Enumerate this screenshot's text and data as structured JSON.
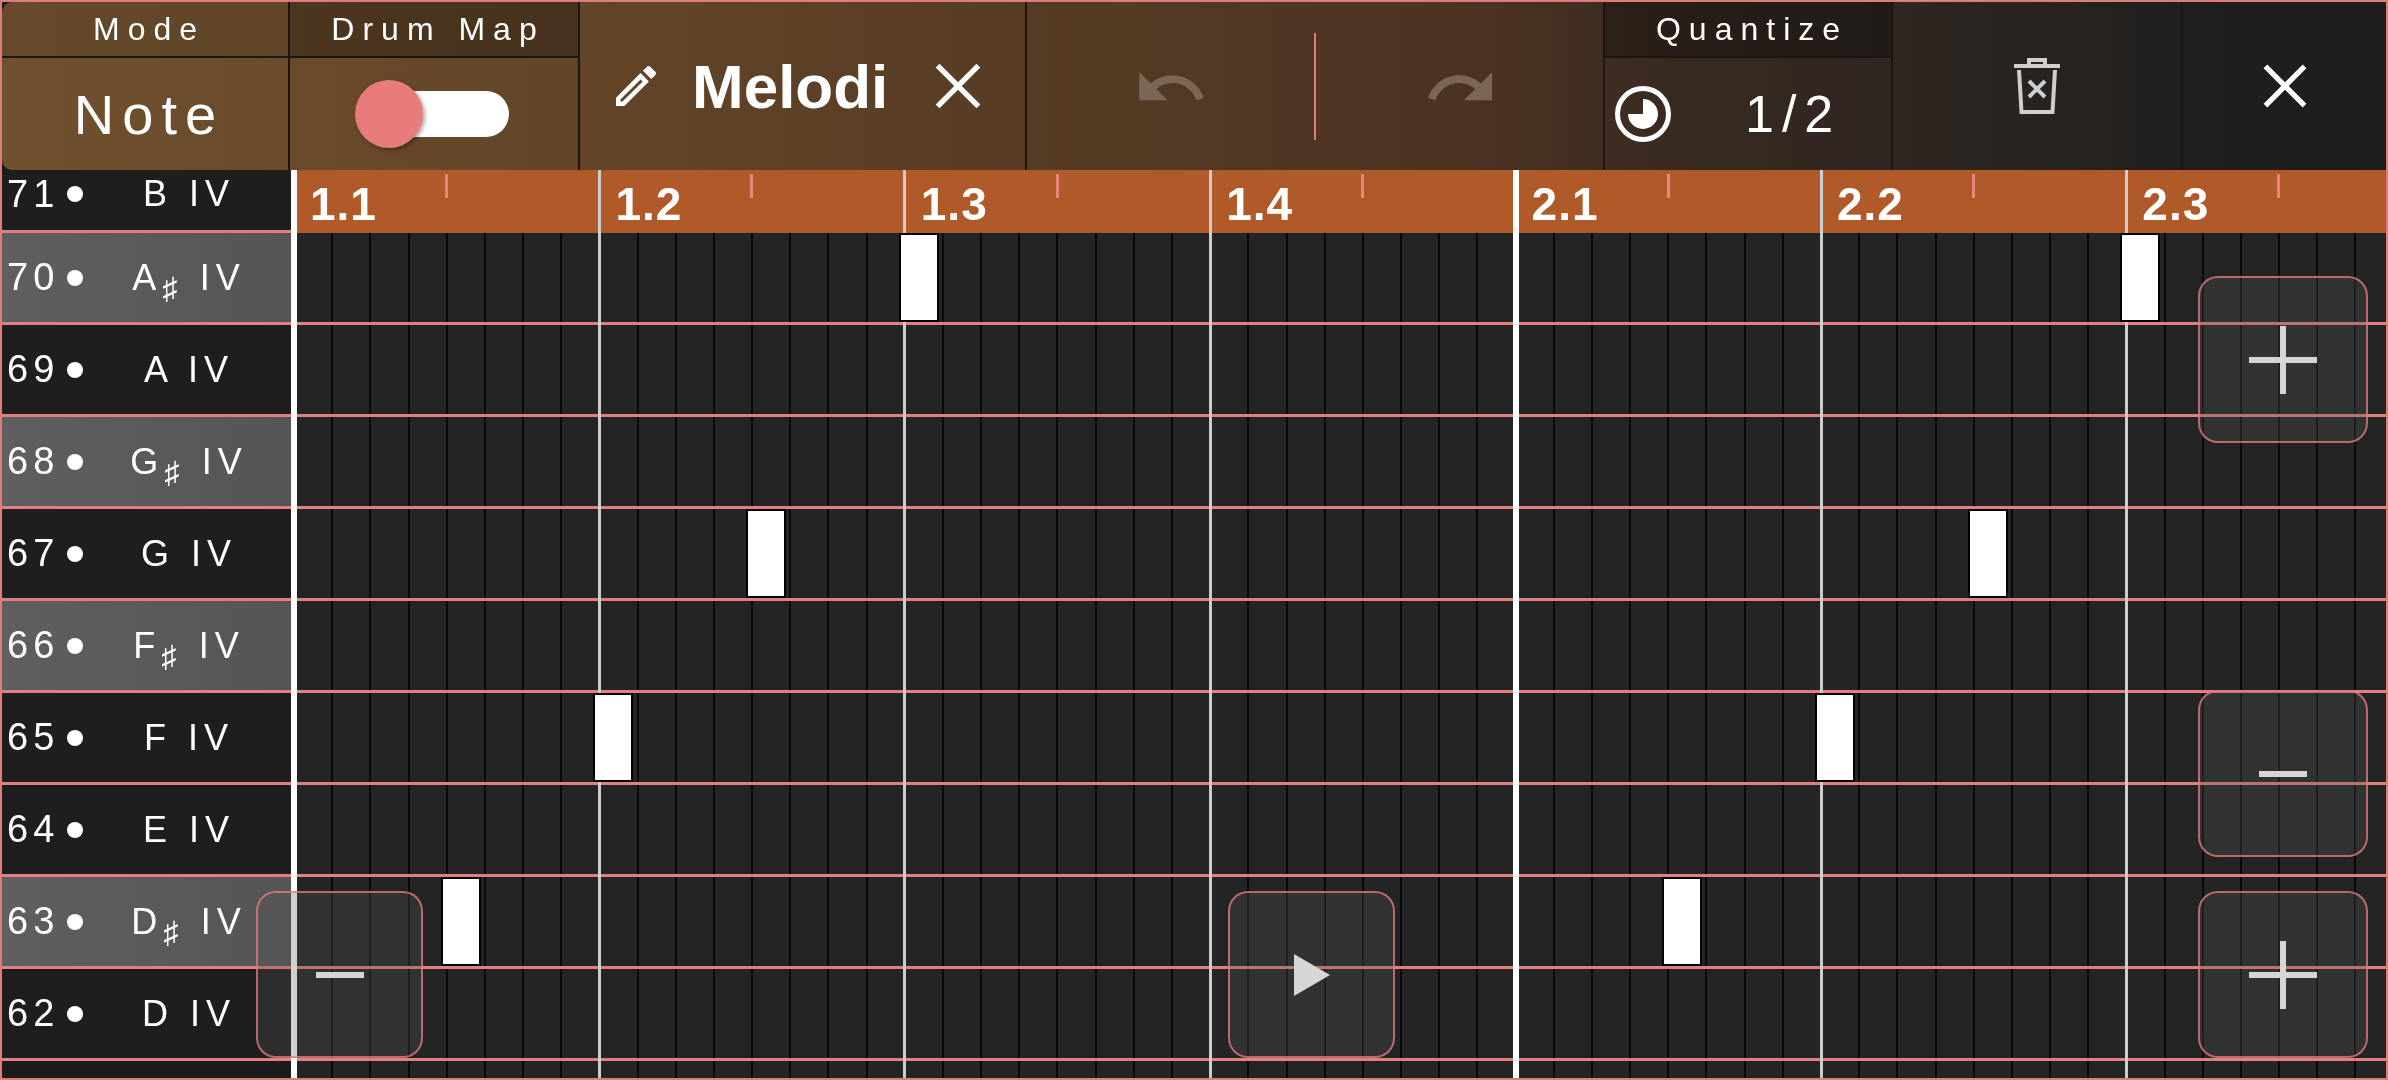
{
  "toolbar": {
    "mode": {
      "label": "Mode",
      "value": "Note"
    },
    "drum_map": {
      "label": "Drum Map",
      "on": false
    },
    "pattern": {
      "name": "Melodi"
    },
    "undo": {
      "disabled": true
    },
    "redo": {
      "disabled": true
    },
    "quantize": {
      "label": "Quantize",
      "value": "1/2"
    }
  },
  "ruler": {
    "beats": [
      {
        "label": "1.1",
        "kind": "bar"
      },
      {
        "label": "1.2",
        "kind": "beat"
      },
      {
        "label": "1.3",
        "kind": "beat"
      },
      {
        "label": "1.4",
        "kind": "beat"
      },
      {
        "label": "2.1",
        "kind": "bar"
      },
      {
        "label": "2.2",
        "kind": "beat"
      },
      {
        "label": "2.3",
        "kind": "beat"
      }
    ]
  },
  "keys": [
    {
      "number": "71",
      "note": "B IV",
      "kind": "natural"
    },
    {
      "number": "70",
      "note": "A$_{♯}$ IV",
      "kind": "sharp",
      "steps": [
        {
          "kind": "rest"
        },
        {
          "kind": "rest"
        },
        {
          "kind": "rest"
        },
        {
          "kind": "rest"
        },
        {
          "kind": "note"
        },
        {
          "kind": "rest"
        },
        {
          "kind": "rest"
        },
        {
          "kind": "rest"
        },
        {
          "kind": "rest"
        },
        {
          "kind": "rest"
        },
        {
          "kind": "rest"
        },
        {
          "kind": "rest"
        },
        {
          "kind": "note"
        },
        {
          "kind": "rest"
        }
      ]
    },
    {
      "number": "69",
      "note": "A IV",
      "kind": "natural",
      "steps": [
        {
          "kind": "rest"
        },
        {
          "kind": "rest"
        },
        {
          "kind": "rest"
        },
        {
          "kind": "rest"
        },
        {
          "kind": "rest"
        },
        {
          "kind": "rest"
        },
        {
          "kind": "rest"
        },
        {
          "kind": "rest"
        },
        {
          "kind": "rest"
        },
        {
          "kind": "rest"
        },
        {
          "kind": "rest"
        },
        {
          "kind": "rest"
        },
        {
          "kind": "rest"
        },
        {
          "kind": "rest"
        }
      ]
    },
    {
      "number": "68",
      "note": "G$_{♯}$ IV",
      "kind": "sharp",
      "steps": [
        {
          "kind": "rest"
        },
        {
          "kind": "rest"
        },
        {
          "kind": "rest"
        },
        {
          "kind": "rest"
        },
        {
          "kind": "rest"
        },
        {
          "kind": "rest"
        },
        {
          "kind": "rest"
        },
        {
          "kind": "rest"
        },
        {
          "kind": "rest"
        },
        {
          "kind": "rest"
        },
        {
          "kind": "rest"
        },
        {
          "kind": "rest"
        },
        {
          "kind": "rest"
        },
        {
          "kind": "rest"
        }
      ]
    },
    {
      "number": "67",
      "note": "G IV",
      "kind": "natural",
      "steps": [
        {
          "kind": "rest"
        },
        {
          "kind": "rest"
        },
        {
          "kind": "rest"
        },
        {
          "kind": "note"
        },
        {
          "kind": "rest"
        },
        {
          "kind": "rest"
        },
        {
          "kind": "rest"
        },
        {
          "kind": "rest"
        },
        {
          "kind": "rest"
        },
        {
          "kind": "rest"
        },
        {
          "kind": "rest"
        },
        {
          "kind": "note"
        },
        {
          "kind": "rest"
        },
        {
          "kind": "rest"
        }
      ]
    },
    {
      "number": "66",
      "note": "F$_{♯}$ IV",
      "kind": "sharp",
      "steps": [
        {
          "kind": "rest"
        },
        {
          "kind": "rest"
        },
        {
          "kind": "rest"
        },
        {
          "kind": "rest"
        },
        {
          "kind": "rest"
        },
        {
          "kind": "rest"
        },
        {
          "kind": "rest"
        },
        {
          "kind": "rest"
        },
        {
          "kind": "rest"
        },
        {
          "kind": "rest"
        },
        {
          "kind": "rest"
        },
        {
          "kind": "rest"
        },
        {
          "kind": "rest"
        },
        {
          "kind": "rest"
        }
      ]
    },
    {
      "number": "65",
      "note": "F IV",
      "kind": "natural",
      "steps": [
        {
          "kind": "rest"
        },
        {
          "kind": "rest"
        },
        {
          "kind": "note"
        },
        {
          "kind": "rest"
        },
        {
          "kind": "rest"
        },
        {
          "kind": "rest"
        },
        {
          "kind": "rest"
        },
        {
          "kind": "rest"
        },
        {
          "kind": "rest"
        },
        {
          "kind": "rest"
        },
        {
          "kind": "note"
        },
        {
          "kind": "rest"
        },
        {
          "kind": "rest"
        },
        {
          "kind": "rest"
        }
      ]
    },
    {
      "number": "64",
      "note": "E IV",
      "kind": "natural",
      "steps": [
        {
          "kind": "rest"
        },
        {
          "kind": "rest"
        },
        {
          "kind": "rest"
        },
        {
          "kind": "rest"
        },
        {
          "kind": "rest"
        },
        {
          "kind": "rest"
        },
        {
          "kind": "rest"
        },
        {
          "kind": "rest"
        },
        {
          "kind": "rest"
        },
        {
          "kind": "rest"
        },
        {
          "kind": "rest"
        },
        {
          "kind": "rest"
        },
        {
          "kind": "rest"
        },
        {
          "kind": "rest"
        }
      ]
    },
    {
      "number": "63",
      "note": "D$_{♯}$ IV",
      "kind": "sharp",
      "steps": [
        {
          "kind": "rest"
        },
        {
          "kind": "note"
        },
        {
          "kind": "rest"
        },
        {
          "kind": "rest"
        },
        {
          "kind": "rest"
        },
        {
          "kind": "rest"
        },
        {
          "kind": "rest"
        },
        {
          "kind": "rest"
        },
        {
          "kind": "rest"
        },
        {
          "kind": "note"
        },
        {
          "kind": "rest"
        },
        {
          "kind": "rest"
        },
        {
          "kind": "rest"
        },
        {
          "kind": "rest"
        }
      ]
    },
    {
      "number": "62",
      "note": "D IV",
      "kind": "natural",
      "steps": [
        {
          "kind": "rest"
        },
        {
          "kind": "rest"
        },
        {
          "kind": "rest"
        },
        {
          "kind": "rest"
        },
        {
          "kind": "rest"
        },
        {
          "kind": "rest"
        },
        {
          "kind": "rest"
        },
        {
          "kind": "rest"
        },
        {
          "kind": "rest"
        },
        {
          "kind": "rest"
        },
        {
          "kind": "rest"
        },
        {
          "kind": "rest"
        },
        {
          "kind": "rest"
        },
        {
          "kind": "rest"
        }
      ]
    }
  ]
}
